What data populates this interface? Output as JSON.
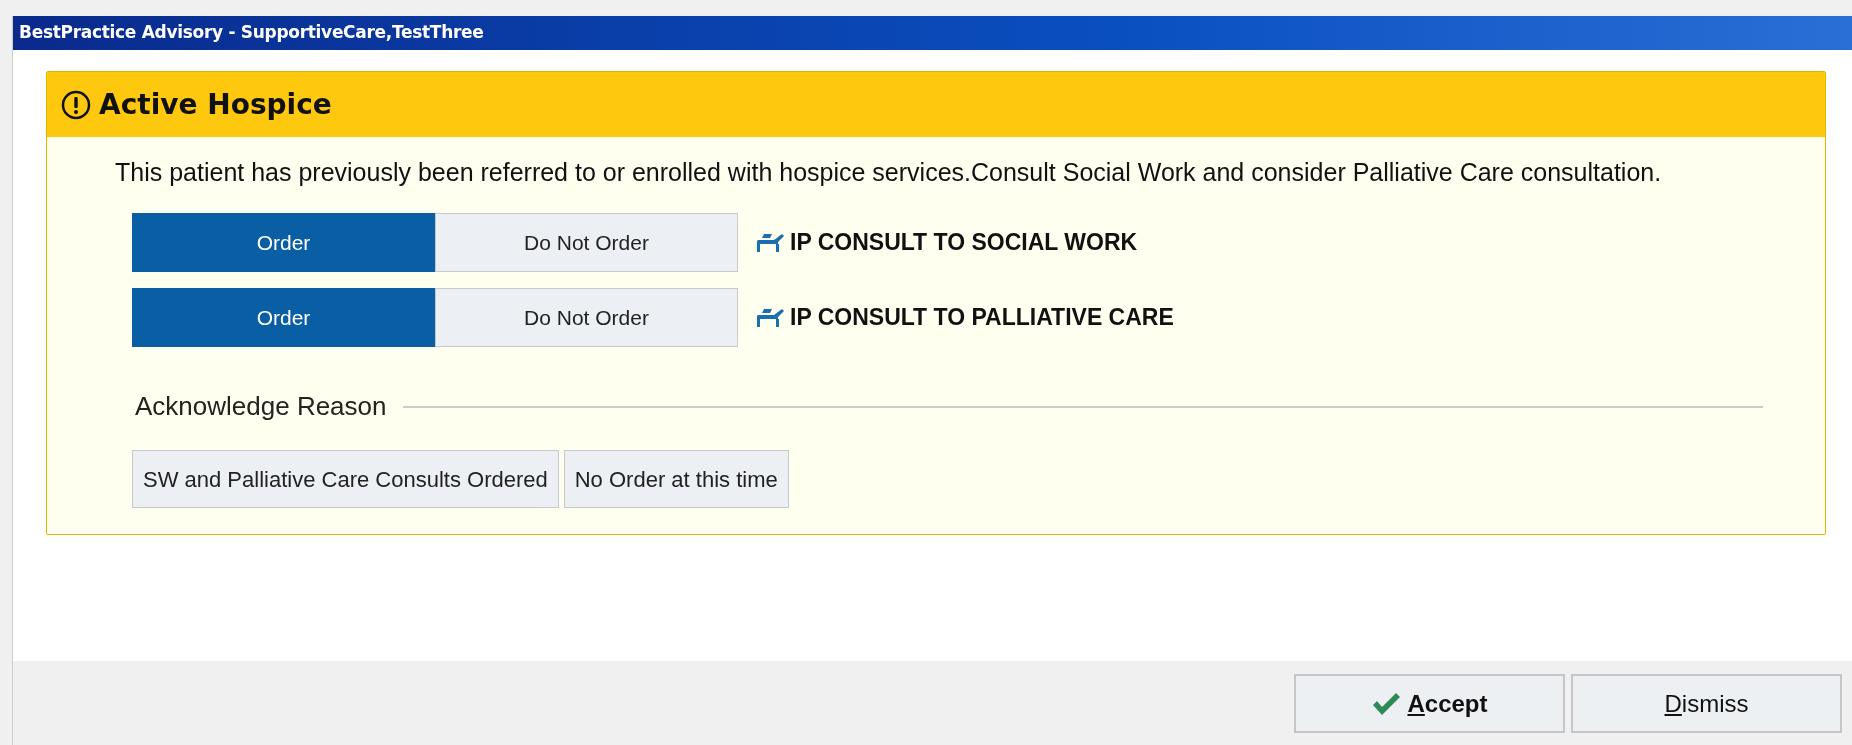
{
  "window": {
    "title": "BestPractice Advisory  - SupportiveCare,TestThree"
  },
  "advisory": {
    "title": "Active Hospice",
    "message": "This patient has previously been referred to or enrolled with hospice services.Consult Social Work and consider Palliative Care consultation.",
    "orders": [
      {
        "name": "IP CONSULT TO SOCIAL WORK",
        "options": [
          {
            "label": "Order",
            "selected": true
          },
          {
            "label": "Do Not Order",
            "selected": false
          }
        ]
      },
      {
        "name": "IP CONSULT TO PALLIATIVE CARE",
        "options": [
          {
            "label": "Order",
            "selected": true
          },
          {
            "label": "Do Not Order",
            "selected": false
          }
        ]
      }
    ],
    "acknowledge": {
      "heading": "Acknowledge Reason",
      "reasons": [
        {
          "label": "SW and Palliative Care Consults Ordered",
          "selected": false
        },
        {
          "label": "No Order at this time",
          "selected": false
        }
      ]
    }
  },
  "footer_buttons": [
    {
      "kind": "accept",
      "mnemonic": "A",
      "rest": "ccept"
    },
    {
      "kind": "dismiss",
      "mnemonic": "D",
      "rest": "ismiss"
    }
  ]
}
